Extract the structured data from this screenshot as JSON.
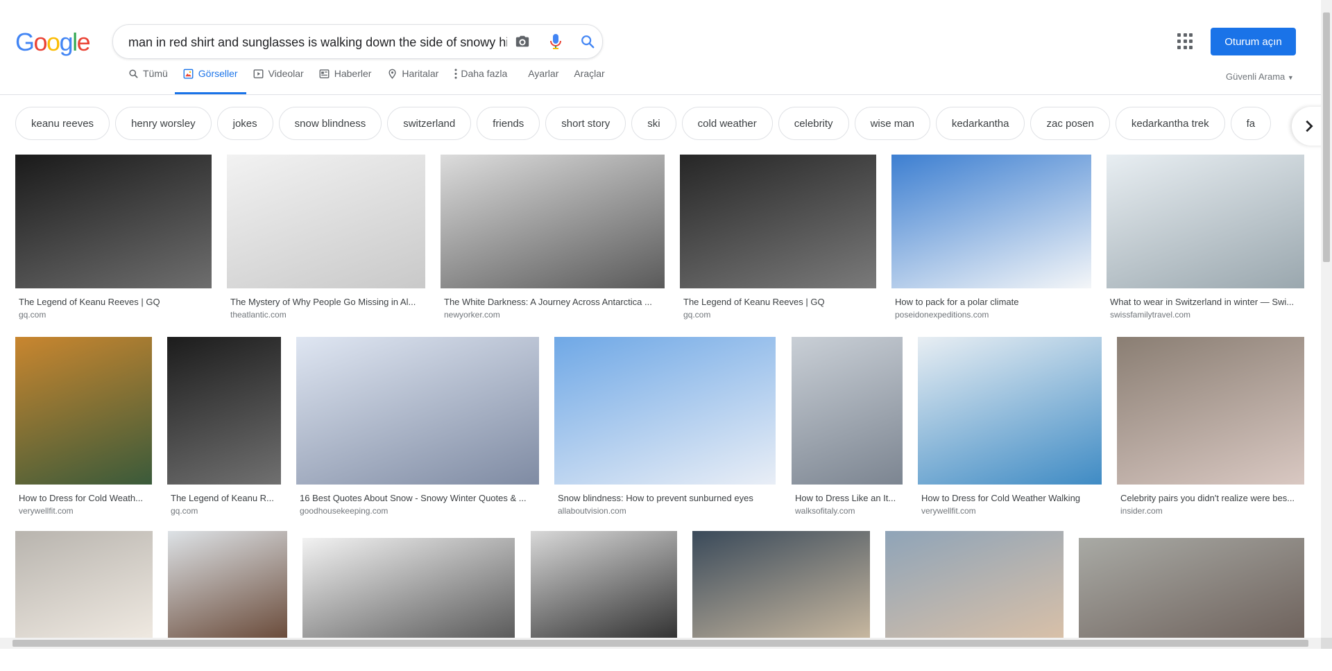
{
  "logo": {
    "letters": [
      "G",
      "o",
      "o",
      "g",
      "l",
      "e"
    ]
  },
  "search": {
    "query": "man in red shirt and sunglasses is walking down the side of snowy hi"
  },
  "tabs": [
    {
      "label": "Tümü",
      "icon": "search-icon",
      "active": false
    },
    {
      "label": "Görseller",
      "icon": "image-icon",
      "active": true
    },
    {
      "label": "Videolar",
      "icon": "video-icon",
      "active": false
    },
    {
      "label": "Haberler",
      "icon": "news-icon",
      "active": false
    },
    {
      "label": "Haritalar",
      "icon": "map-pin-icon",
      "active": false
    },
    {
      "label": "Daha fazla",
      "icon": "more-vert-icon",
      "active": false
    },
    {
      "label": "Ayarlar",
      "icon": "",
      "active": false
    },
    {
      "label": "Araçlar",
      "icon": "",
      "active": false
    }
  ],
  "header": {
    "signin_label": "Oturum açın",
    "safe_search_label": "Güvenli Arama"
  },
  "chips": [
    "keanu reeves",
    "henry worsley",
    "jokes",
    "snow blindness",
    "switzerland",
    "friends",
    "short story",
    "ski",
    "cold weather",
    "celebrity",
    "wise man",
    "kedarkantha",
    "zac posen",
    "kedarkantha trek",
    "fa"
  ],
  "results": [
    {
      "title": "The Legend of Keanu Reeves | GQ",
      "source": "gq.com",
      "colors": [
        "#1a1a1a",
        "#6e6e6e"
      ]
    },
    {
      "title": "The Mystery of Why People Go Missing in Al...",
      "source": "theatlantic.com",
      "colors": [
        "#f2f2f2",
        "#c9c9c9"
      ]
    },
    {
      "title": "The White Darkness: A Journey Across Antarctica ...",
      "source": "newyorker.com",
      "colors": [
        "#dcdcdc",
        "#5a5a5a"
      ]
    },
    {
      "title": "The Legend of Keanu Reeves | GQ",
      "source": "gq.com",
      "colors": [
        "#262626",
        "#7a7a7a"
      ]
    },
    {
      "title": "How to pack for a polar climate",
      "source": "poseidonexpeditions.com",
      "colors": [
        "#3d7fd1",
        "#f4f6f8"
      ]
    },
    {
      "title": "What to wear in Switzerland in winter — Swi...",
      "source": "swissfamilytravel.com",
      "colors": [
        "#e8eef2",
        "#9aa7ae"
      ]
    },
    {
      "title": "How to Dress for Cold Weath...",
      "source": "verywellfit.com",
      "colors": [
        "#c9862f",
        "#3a5a3a"
      ]
    },
    {
      "title": "The Legend of Keanu R...",
      "source": "gq.com",
      "colors": [
        "#1c1c1c",
        "#707070"
      ]
    },
    {
      "title": "16 Best Quotes About Snow - Snowy Winter Quotes & ...",
      "source": "goodhousekeeping.com",
      "colors": [
        "#dfe6f2",
        "#7f8ba3"
      ]
    },
    {
      "title": "Snow blindness: How to prevent sunburned eyes",
      "source": "allaboutvision.com",
      "colors": [
        "#6fa8e6",
        "#e9eef6"
      ]
    },
    {
      "title": "How to Dress Like an It...",
      "source": "walksofitaly.com",
      "colors": [
        "#c9cfd6",
        "#7c8591"
      ]
    },
    {
      "title": "How to Dress for Cold Weather Walking",
      "source": "verywellfit.com",
      "colors": [
        "#e8eef3",
        "#3f8bc4"
      ]
    },
    {
      "title": "Celebrity pairs you didn't realize were bes...",
      "source": "insider.com",
      "colors": [
        "#8a7e73",
        "#d9c8c2"
      ]
    },
    {
      "title": "",
      "source": "",
      "colors": [
        "#b8b4ae",
        "#efe9e1"
      ]
    },
    {
      "title": "",
      "source": "",
      "colors": [
        "#dde2e6",
        "#6b4c3b"
      ]
    },
    {
      "title": "",
      "source": "",
      "colors": [
        "#f2f2f2",
        "#5b5b5b"
      ]
    },
    {
      "title": "",
      "source": "",
      "colors": [
        "#d8d8d8",
        "#333333"
      ]
    },
    {
      "title": "",
      "source": "",
      "colors": [
        "#3a4a5a",
        "#c7b79f"
      ]
    },
    {
      "title": "",
      "source": "",
      "colors": [
        "#8fa4b8",
        "#d8c0a8"
      ]
    },
    {
      "title": "",
      "source": "",
      "colors": [
        "#a9aaa5",
        "#6e625c"
      ]
    }
  ]
}
